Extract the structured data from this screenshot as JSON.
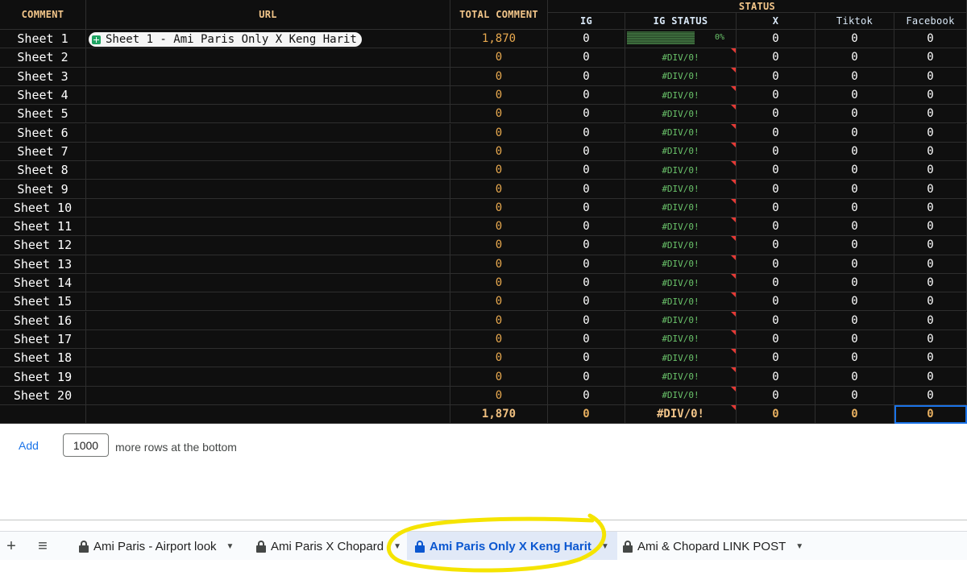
{
  "headers": {
    "comment": "COMMENT",
    "url": "URL",
    "total_comment": "TOTAL COMMENT",
    "status": "STATUS",
    "ig": "IG",
    "ig_status": "IG STATUS",
    "x": "X",
    "tiktok": "Tiktok",
    "facebook": "Facebook"
  },
  "rows": [
    {
      "name": "Sheet 1",
      "url": "Sheet 1  - Ami Paris Only X Keng Harit",
      "total": "1,870",
      "ig": "0",
      "ig_status": "0%",
      "ig_status_progress": 0,
      "x": "0",
      "tiktok": "0",
      "facebook": "0"
    },
    {
      "name": "Sheet 2",
      "url": "",
      "total": "0",
      "ig": "0",
      "ig_status": "#DIV/0!",
      "x": "0",
      "tiktok": "0",
      "facebook": "0"
    },
    {
      "name": "Sheet 3",
      "url": "",
      "total": "0",
      "ig": "0",
      "ig_status": "#DIV/0!",
      "x": "0",
      "tiktok": "0",
      "facebook": "0"
    },
    {
      "name": "Sheet 4",
      "url": "",
      "total": "0",
      "ig": "0",
      "ig_status": "#DIV/0!",
      "x": "0",
      "tiktok": "0",
      "facebook": "0"
    },
    {
      "name": "Sheet 5",
      "url": "",
      "total": "0",
      "ig": "0",
      "ig_status": "#DIV/0!",
      "x": "0",
      "tiktok": "0",
      "facebook": "0"
    },
    {
      "name": "Sheet 6",
      "url": "",
      "total": "0",
      "ig": "0",
      "ig_status": "#DIV/0!",
      "x": "0",
      "tiktok": "0",
      "facebook": "0"
    },
    {
      "name": "Sheet 7",
      "url": "",
      "total": "0",
      "ig": "0",
      "ig_status": "#DIV/0!",
      "x": "0",
      "tiktok": "0",
      "facebook": "0"
    },
    {
      "name": "Sheet 8",
      "url": "",
      "total": "0",
      "ig": "0",
      "ig_status": "#DIV/0!",
      "x": "0",
      "tiktok": "0",
      "facebook": "0"
    },
    {
      "name": "Sheet 9",
      "url": "",
      "total": "0",
      "ig": "0",
      "ig_status": "#DIV/0!",
      "x": "0",
      "tiktok": "0",
      "facebook": "0"
    },
    {
      "name": "Sheet 10",
      "url": "",
      "total": "0",
      "ig": "0",
      "ig_status": "#DIV/0!",
      "x": "0",
      "tiktok": "0",
      "facebook": "0"
    },
    {
      "name": "Sheet 11",
      "url": "",
      "total": "0",
      "ig": "0",
      "ig_status": "#DIV/0!",
      "x": "0",
      "tiktok": "0",
      "facebook": "0"
    },
    {
      "name": "Sheet 12",
      "url": "",
      "total": "0",
      "ig": "0",
      "ig_status": "#DIV/0!",
      "x": "0",
      "tiktok": "0",
      "facebook": "0"
    },
    {
      "name": "Sheet 13",
      "url": "",
      "total": "0",
      "ig": "0",
      "ig_status": "#DIV/0!",
      "x": "0",
      "tiktok": "0",
      "facebook": "0"
    },
    {
      "name": "Sheet 14",
      "url": "",
      "total": "0",
      "ig": "0",
      "ig_status": "#DIV/0!",
      "x": "0",
      "tiktok": "0",
      "facebook": "0"
    },
    {
      "name": "Sheet 15",
      "url": "",
      "total": "0",
      "ig": "0",
      "ig_status": "#DIV/0!",
      "x": "0",
      "tiktok": "0",
      "facebook": "0"
    },
    {
      "name": "Sheet 16",
      "url": "",
      "total": "0",
      "ig": "0",
      "ig_status": "#DIV/0!",
      "x": "0",
      "tiktok": "0",
      "facebook": "0"
    },
    {
      "name": "Sheet 17",
      "url": "",
      "total": "0",
      "ig": "0",
      "ig_status": "#DIV/0!",
      "x": "0",
      "tiktok": "0",
      "facebook": "0"
    },
    {
      "name": "Sheet 18",
      "url": "",
      "total": "0",
      "ig": "0",
      "ig_status": "#DIV/0!",
      "x": "0",
      "tiktok": "0",
      "facebook": "0"
    },
    {
      "name": "Sheet 19",
      "url": "",
      "total": "0",
      "ig": "0",
      "ig_status": "#DIV/0!",
      "x": "0",
      "tiktok": "0",
      "facebook": "0"
    },
    {
      "name": "Sheet 20",
      "url": "",
      "total": "0",
      "ig": "0",
      "ig_status": "#DIV/0!",
      "x": "0",
      "tiktok": "0",
      "facebook": "0"
    }
  ],
  "footer": {
    "total": "1,870",
    "ig": "0",
    "ig_status": "#DIV/0!",
    "x": "0",
    "tiktok": "0",
    "facebook": "0"
  },
  "add_rows": {
    "link": "Add",
    "count": "1000",
    "text": "more rows at the bottom"
  },
  "tabs": [
    {
      "label": "Ami Paris - Airport look",
      "active": false
    },
    {
      "label": "Ami Paris X Chopard",
      "active": false
    },
    {
      "label": "Ami Paris Only X Keng Harit",
      "active": true
    },
    {
      "label": "Ami & Chopard LINK POST",
      "active": false
    }
  ],
  "icons": {
    "add_sheet": "plus-icon",
    "all_sheets": "menu-icon",
    "lock": "lock-icon",
    "dropdown": "caret-down-icon"
  },
  "colors": {
    "grid_bg": "#0f0f0f",
    "header_text": "#f3c68a",
    "total_text": "#e8a94f",
    "div_text": "#6ac36a",
    "active_tab_bg": "#e1e9f7",
    "active_tab_text": "#0b57d0",
    "highlight": "#f5e400"
  }
}
